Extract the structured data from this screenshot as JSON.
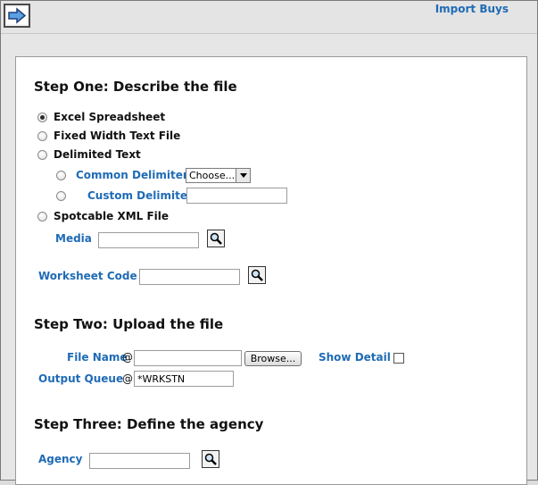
{
  "header": {
    "title": "Import Buys",
    "nav_icon": "forward-arrow-icon"
  },
  "step_one": {
    "title": "Step One: Describe the file",
    "options": {
      "excel": "Excel Spreadsheet",
      "fixed_width": "Fixed Width Text File",
      "delimited": "Delimited Text",
      "spotcable_xml": "Spotcable XML File"
    },
    "selected": "excel",
    "common_delimiters_label": "Common Delimiters",
    "common_delimiters_value": "Choose...",
    "custom_delimiter_label": "Custom Delimiter",
    "custom_delimiter_value": "",
    "media_label": "Media",
    "media_value": "",
    "worksheet_code_label": "Worksheet Code",
    "worksheet_code_value": ""
  },
  "step_two": {
    "title": "Step Two: Upload the file",
    "file_name_label": "File Name",
    "file_name_at": "@",
    "file_name_value": "",
    "browse_label": "Browse...",
    "show_detail_label": "Show Detail",
    "show_detail_checked": false,
    "output_queue_label": "Output Queue",
    "output_queue_at": "@",
    "output_queue_value": "*WRKSTN"
  },
  "step_three": {
    "title": "Step Three: Define the agency",
    "agency_label": "Agency",
    "agency_value": ""
  },
  "colors": {
    "accent": "#1f6bb5",
    "background": "#e6e6e6",
    "panel": "#ffffff"
  }
}
